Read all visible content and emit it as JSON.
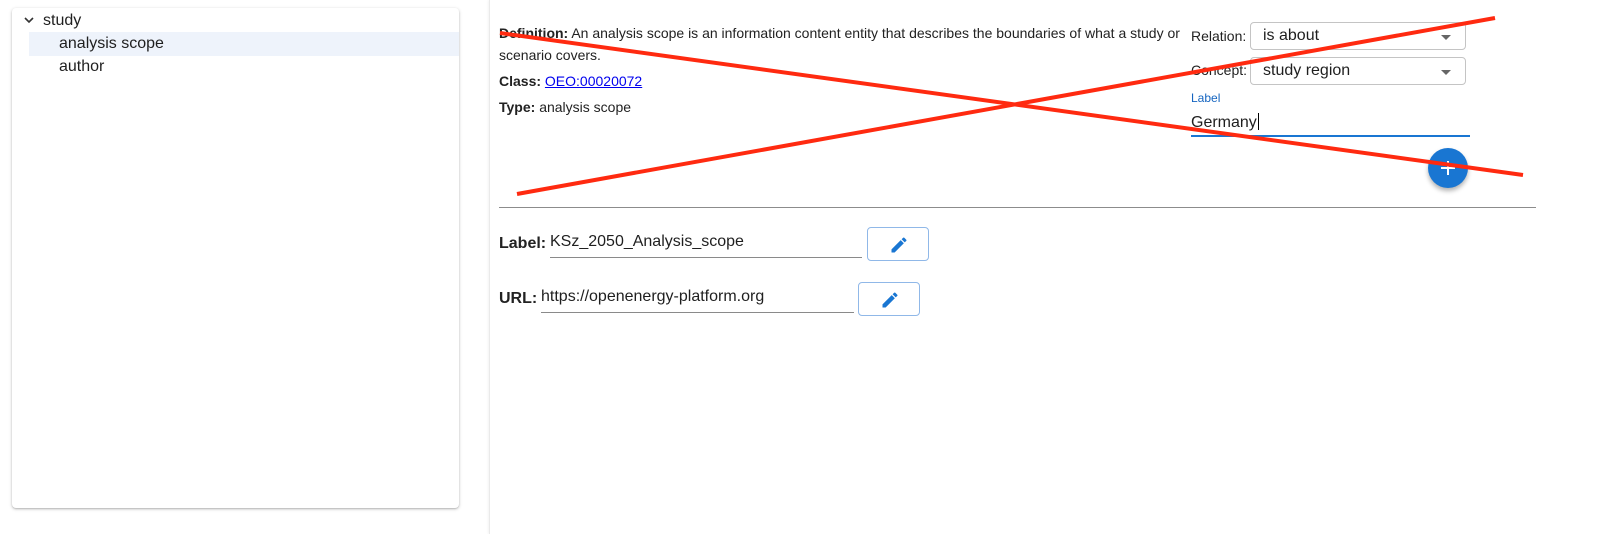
{
  "tree": {
    "root_label": "study",
    "items": [
      {
        "label": "analysis scope",
        "selected": true
      },
      {
        "label": "author",
        "selected": false
      }
    ]
  },
  "details": {
    "definition_label": "Definition:",
    "definition_text": "An analysis scope is an information content entity that describes the boundaries of what a study or scenario covers.",
    "definition_line1": "An analysis scope is an information content entity that describes the boundaries of what a study or",
    "definition_line2": "scenario covers.",
    "class_label": "Class:",
    "class_value": "OEO:00020072",
    "type_label": "Type:",
    "type_value": "analysis scope"
  },
  "relation_form": {
    "relation_label": "Relation:",
    "relation_value": "is about",
    "concept_label": "Concept:",
    "concept_value": "study region",
    "label_caption": "Label",
    "label_value": "Germany"
  },
  "properties": {
    "label_caption": "Label:",
    "label_value": "KSz_2050_Analysis_scope",
    "url_caption": "URL:",
    "url_value": "https://openenergy-platform.org"
  },
  "colors": {
    "accent": "#1976d2",
    "annotation_cross": "#ff2a10",
    "selected_row": "#eef3fb"
  },
  "icons": [
    "chevron-down-icon",
    "plus-icon",
    "pencil-icon"
  ]
}
